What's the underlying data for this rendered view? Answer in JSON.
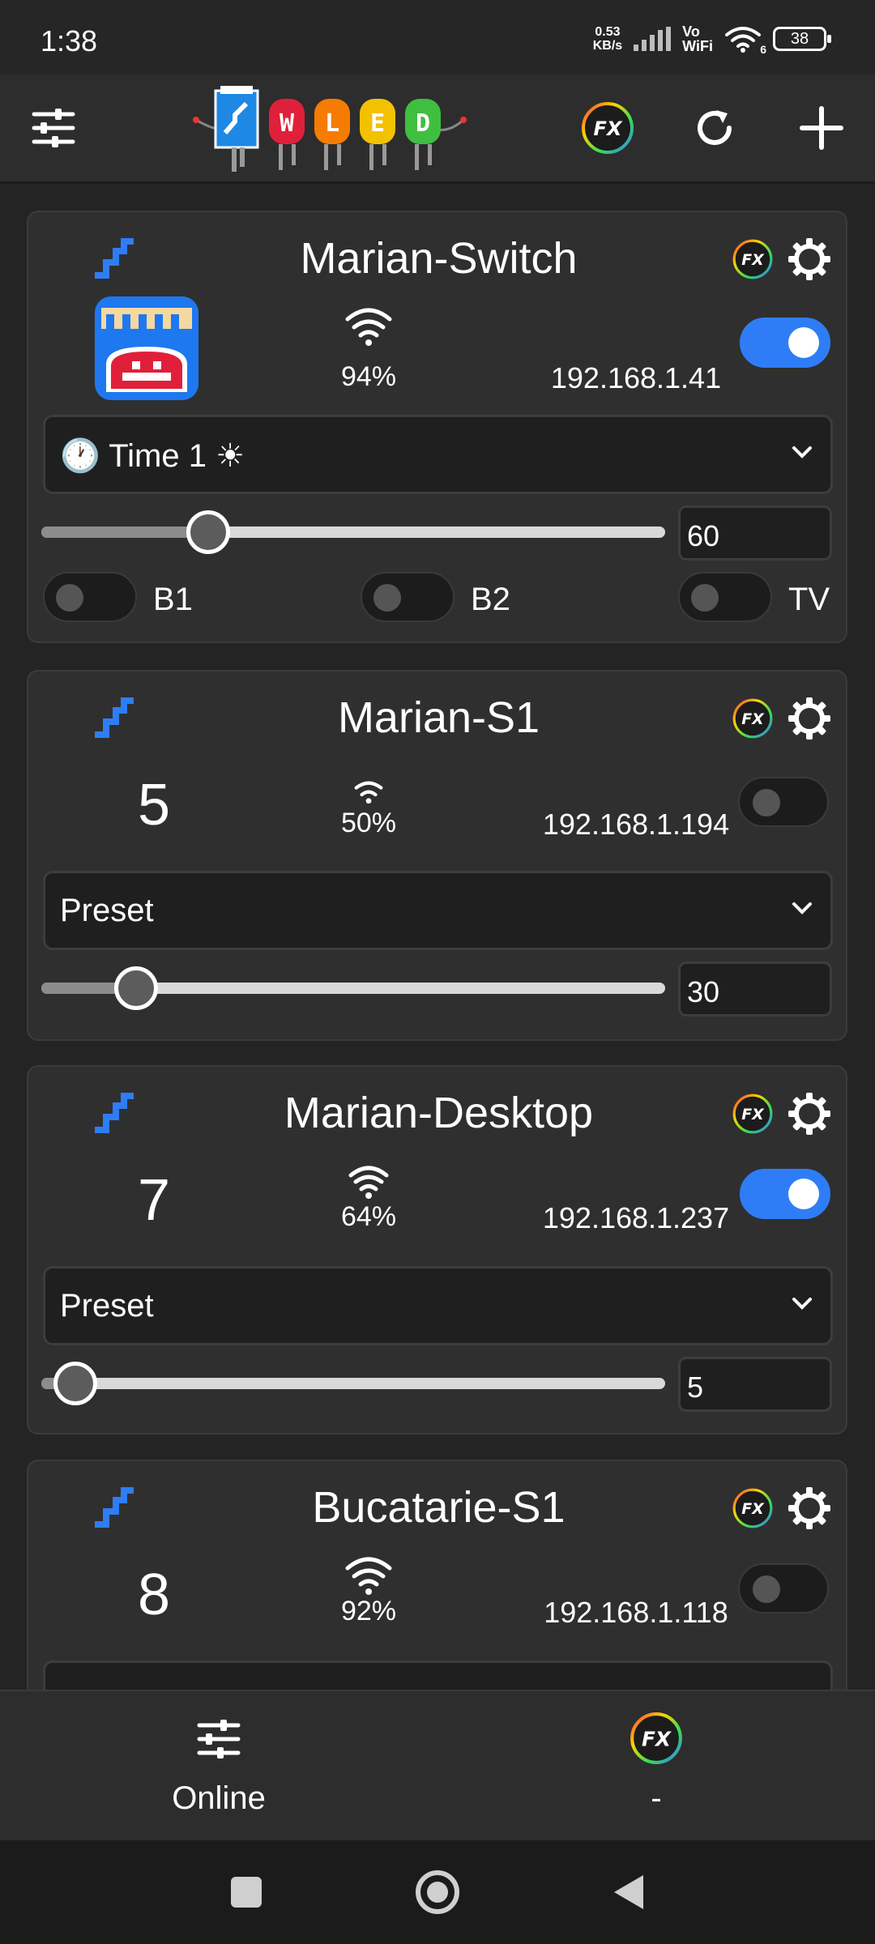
{
  "status_bar": {
    "time": "1:38",
    "net_speed_value": "0.53",
    "net_speed_unit": "KB/s",
    "vowifi_top": "Vo",
    "vowifi_bottom": "WiFi",
    "wifi_badge": "6",
    "battery": "38"
  },
  "header": {
    "logo_text": "WLED",
    "icons": [
      "sliders-icon",
      "fx-icon",
      "refresh-icon",
      "add-icon"
    ]
  },
  "devices": [
    {
      "name": "Marian-Switch",
      "rssi": "94%",
      "ip": "192.168.1.41",
      "power_on": true,
      "selected": "🕐 Time 1 ☀",
      "brightness": 60,
      "brightness_label": "60",
      "switches": [
        {
          "label": "B1",
          "on": false
        },
        {
          "label": "B2",
          "on": false
        },
        {
          "label": "TV",
          "on": false
        }
      ]
    },
    {
      "name": "Marian-S1",
      "number": "5",
      "rssi": "50%",
      "ip": "192.168.1.194",
      "power_on": false,
      "selected": "Preset",
      "brightness": 30,
      "brightness_label": "30"
    },
    {
      "name": "Marian-Desktop",
      "number": "7",
      "rssi": "64%",
      "ip": "192.168.1.237",
      "power_on": true,
      "selected": "Preset",
      "brightness": 5,
      "brightness_label": "5"
    },
    {
      "name": "Bucatarie-S1",
      "number": "8",
      "rssi": "92%",
      "ip": "192.168.1.118",
      "power_on": false
    }
  ],
  "bottom_nav": {
    "online_label": "Online",
    "fx_label": "-"
  },
  "colors": {
    "accent": "#2f7df6",
    "background": "#242424",
    "card": "#2f2f2f"
  }
}
